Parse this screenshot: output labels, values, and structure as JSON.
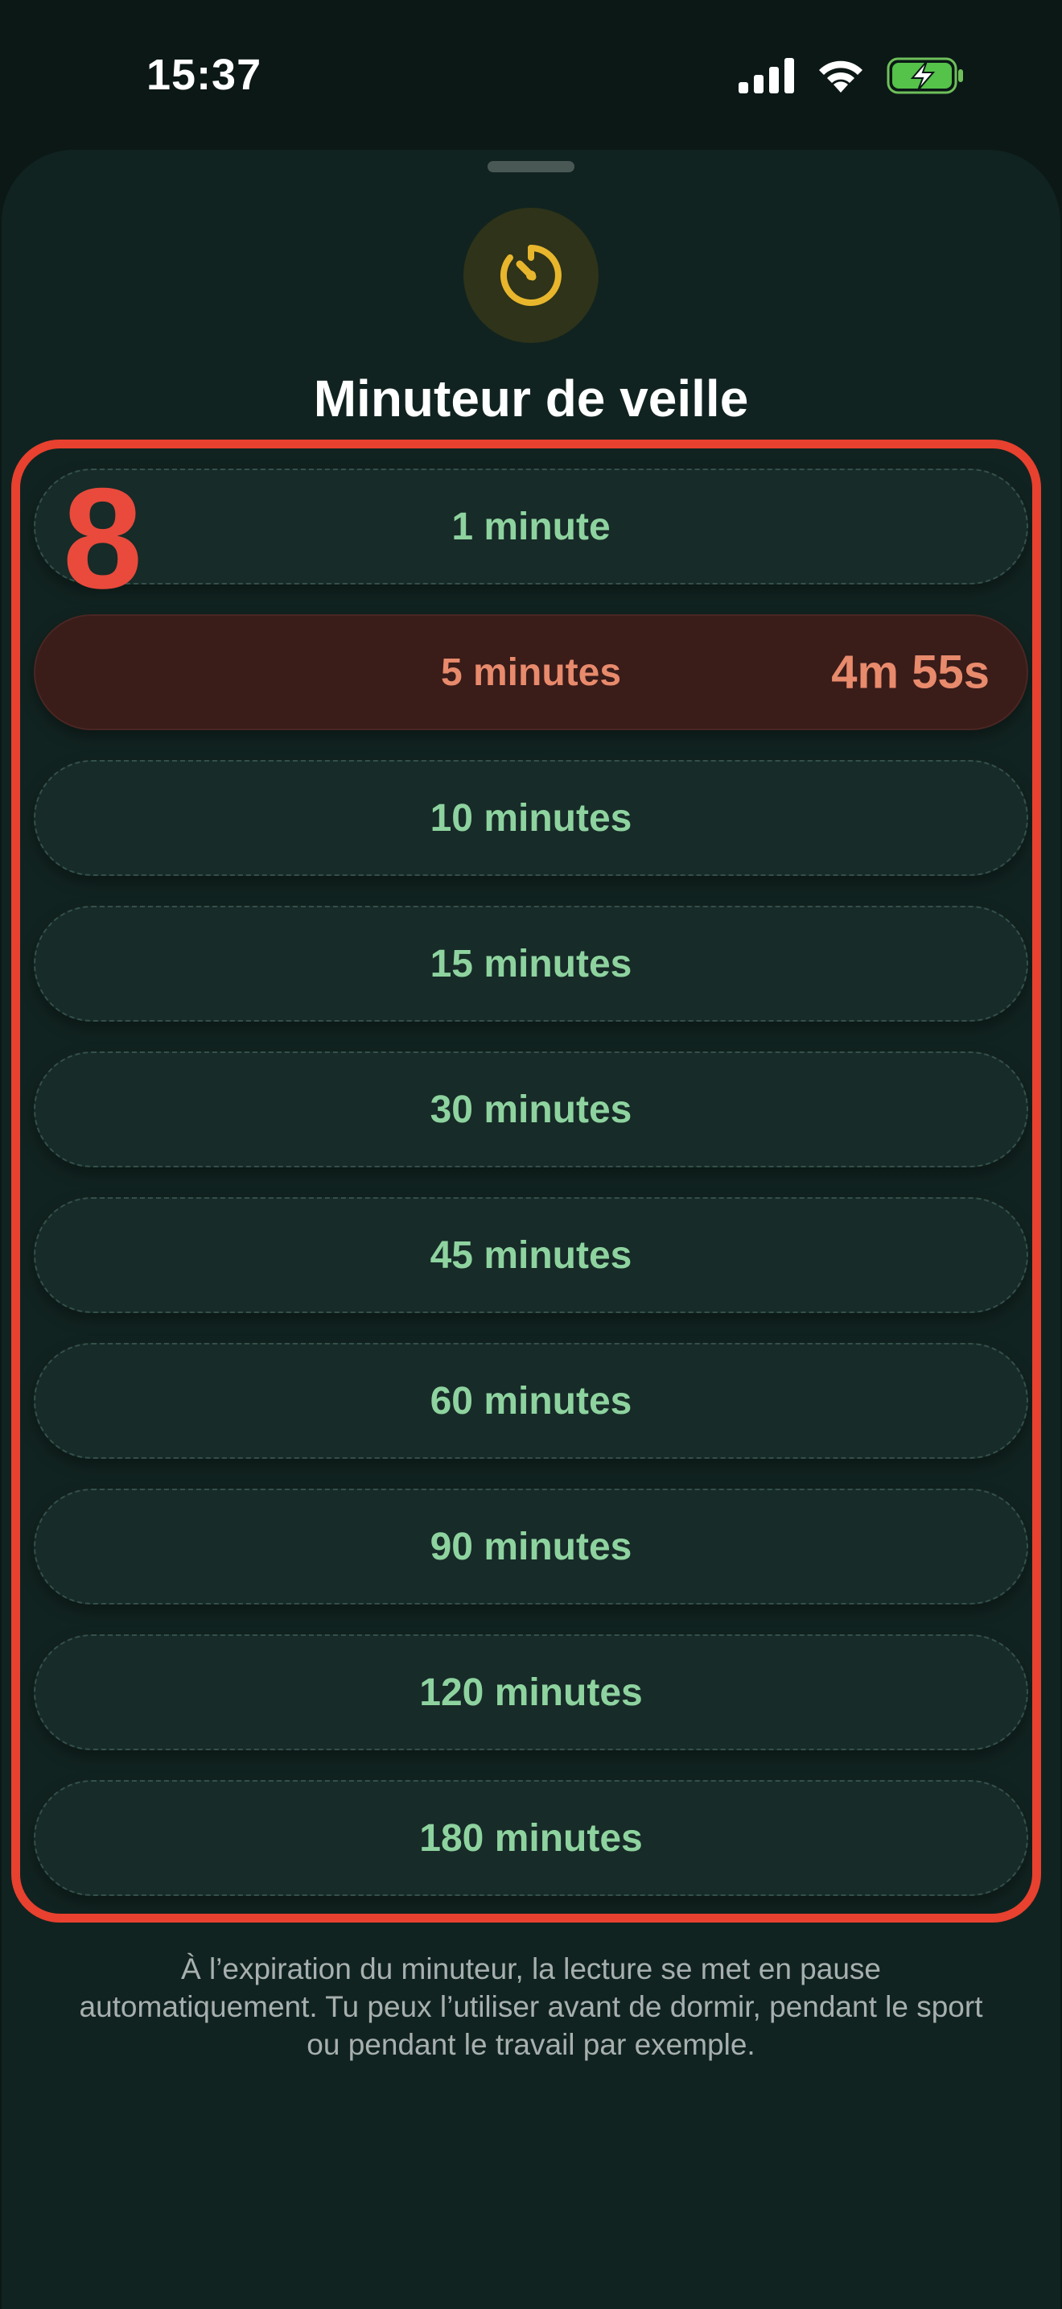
{
  "status_bar": {
    "time": "15:37"
  },
  "sheet": {
    "title": "Minuteur de veille",
    "icon": "timer-icon",
    "annotation": "8",
    "options": [
      {
        "label": "1 minute",
        "remaining": ""
      },
      {
        "label": "5 minutes",
        "remaining": "4m 55s",
        "active": true
      },
      {
        "label": "10 minutes",
        "remaining": ""
      },
      {
        "label": "15 minutes",
        "remaining": ""
      },
      {
        "label": "30 minutes",
        "remaining": ""
      },
      {
        "label": "45 minutes",
        "remaining": ""
      },
      {
        "label": "60 minutes",
        "remaining": ""
      },
      {
        "label": "90 minutes",
        "remaining": ""
      },
      {
        "label": "120 minutes",
        "remaining": ""
      },
      {
        "label": "180 minutes",
        "remaining": ""
      }
    ],
    "footnote": "À l’expiration du minuteur, la lecture se met en pause automatiquement. Tu peux l’utiliser avant de dormir, pendant le sport ou pendant le travail par exemple."
  },
  "colors": {
    "background": "#0b1816",
    "sheet": "#112320",
    "option_text": "#8ed39f",
    "active_option_bg": "#3a1c19",
    "active_option_text": "#e88a6c",
    "highlight": "#e8412f",
    "timer_accent": "#e8b62d"
  }
}
